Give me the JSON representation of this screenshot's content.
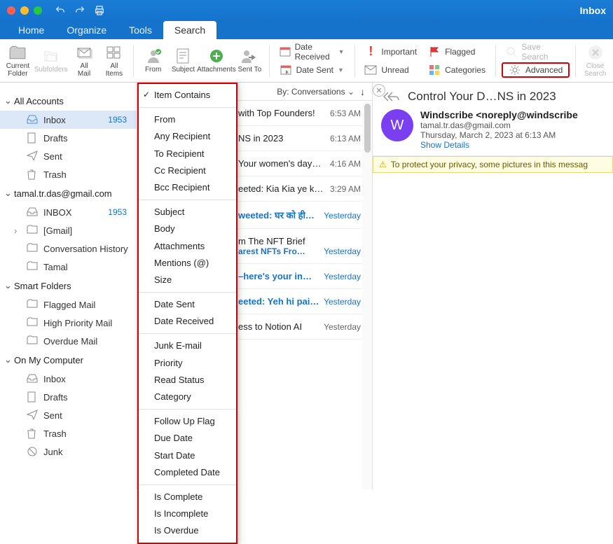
{
  "window": {
    "title": "Inbox"
  },
  "tabs": [
    "Home",
    "Organize",
    "Tools",
    "Search"
  ],
  "active_tab": "Search",
  "ribbon": {
    "current_folder": "Current\nFolder",
    "subfolders": "Subfolders",
    "all_mail": "All\nMail",
    "all_items": "All\nItems",
    "from": "From",
    "subject": "Subject",
    "attachments": "Attachments",
    "sent_to": "Sent To",
    "date_received": "Date Received",
    "date_sent": "Date Sent",
    "important": "Important",
    "unread": "Unread",
    "flagged": "Flagged",
    "categories": "Categories",
    "save_search": "Save Search",
    "advanced": "Advanced",
    "close_search": "Close\nSearch"
  },
  "sidebar": {
    "all_accounts": "All Accounts",
    "inbox": "Inbox",
    "inbox_count": "1953",
    "drafts": "Drafts",
    "sent": "Sent",
    "trash": "Trash",
    "account": "tamal.tr.das@gmail.com",
    "acc_inbox": "INBOX",
    "acc_inbox_count": "1953",
    "gmail": "[Gmail]",
    "conv_history": "Conversation History",
    "tamal": "Tamal",
    "smart_folders": "Smart Folders",
    "flagged_mail": "Flagged Mail",
    "high_priority": "High Priority Mail",
    "overdue": "Overdue Mail",
    "on_my_computer": "On My Computer",
    "omc_inbox": "Inbox",
    "omc_drafts": "Drafts",
    "omc_sent": "Sent",
    "omc_trash": "Trash",
    "omc_junk": "Junk"
  },
  "list": {
    "sort_label": "By: Conversations",
    "items": [
      {
        "subject": "with Top Founders!",
        "time": "6:53 AM"
      },
      {
        "subject": "NS in 2023",
        "time": "6:13 AM"
      },
      {
        "subject": "Your women's day…",
        "time": "4:16 AM"
      },
      {
        "subject": "eeted: Kia Kia ye k…",
        "time": "3:29 AM"
      },
      {
        "subject_link": "weeted: घर को ही…",
        "time": "Yesterday",
        "link": true
      },
      {
        "subject": "m The NFT Brief",
        "snip_link": "arest NFTs Fro…",
        "time": "Yesterday",
        "two": true
      },
      {
        "subject_link": "–here's your in…",
        "time": "Yesterday",
        "link": true
      },
      {
        "subject_link": "eeted: Yeh hi pai…",
        "time": "Yesterday",
        "link": true
      },
      {
        "subject": "ess to Notion AI",
        "time": "Yesterday"
      }
    ]
  },
  "reader": {
    "subject": "Control Your D…NS in 2023",
    "from": "Windscribe <noreply@windscribe",
    "to": "tamal.tr.das@gmail.com",
    "date": "Thursday, March 2, 2023 at 6:13 AM",
    "show_details": "Show Details",
    "avatar": "W",
    "privacy": "To protect your privacy, some pictures in this messag"
  },
  "dropdown": {
    "groups": [
      [
        "Item Contains"
      ],
      [
        "From",
        "Any Recipient",
        "To Recipient",
        "Cc Recipient",
        "Bcc Recipient"
      ],
      [
        "Subject",
        "Body",
        "Attachments",
        "Mentions (@)",
        "Size"
      ],
      [
        "Date Sent",
        "Date Received"
      ],
      [
        "Junk E-mail",
        "Priority",
        "Read Status",
        "Category"
      ],
      [
        "Follow Up Flag",
        "Due Date",
        "Start Date",
        "Completed Date"
      ],
      [
        "Is Complete",
        "Is Incomplete",
        "Is Overdue"
      ]
    ],
    "checked": "Item Contains"
  }
}
